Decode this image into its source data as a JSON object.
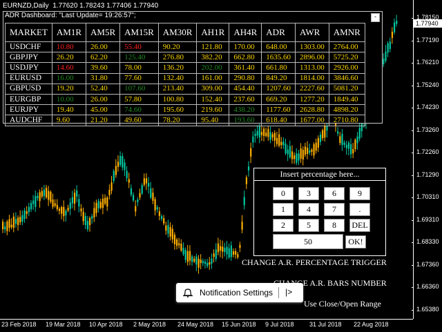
{
  "chart": {
    "title": "EURNZD,Daily  1.77620 1.78243 1.77406 1.77940",
    "current_price": "1.77940",
    "up_color": "#00c8a0",
    "down_color": "#ffb000",
    "price_labels": [
      "1.78150",
      "1.77190",
      "1.76210",
      "1.75240",
      "1.74230",
      "1.73260",
      "1.72260",
      "1.71290",
      "1.70310",
      "1.69310",
      "1.68330",
      "1.67360",
      "1.66360",
      "1.65380"
    ],
    "time_labels": [
      "23 Feb 2018",
      "19 Mar 2018",
      "10 Apr 2018",
      "2 May 2018",
      "24 May 2018",
      "15 Jun 2018",
      "9 Jul 2018",
      "31 Jul 2018",
      "22 Aug 2018"
    ]
  },
  "dashboard": {
    "title": "ADR Dashboard: \"Last Update= 19:26:57\";",
    "close_label": "-",
    "headers": [
      "MARKET",
      "AM1R",
      "AM5R",
      "AM15R",
      "AM30R",
      "AH1R",
      "AH4R",
      "ADR",
      "AWR",
      "AMNR"
    ],
    "rows": [
      {
        "symbol": "USDCHF",
        "cells": [
          {
            "v": "10.80",
            "c": "#ff2020"
          },
          {
            "v": "26.00",
            "c": "#ffd700"
          },
          {
            "v": "55.40",
            "c": "#ff2020"
          },
          {
            "v": "90.20",
            "c": "#ffd700"
          },
          {
            "v": "121.80",
            "c": "#ffd700"
          },
          {
            "v": "170.00",
            "c": "#ffd700"
          },
          {
            "v": "648.00",
            "c": "#ffd700"
          },
          {
            "v": "1303.00",
            "c": "#ffd700"
          },
          {
            "v": "2764.00",
            "c": "#ffd700"
          }
        ]
      },
      {
        "symbol": "GBPJPY",
        "cells": [
          {
            "v": "26.20",
            "c": "#ffd700"
          },
          {
            "v": "62.20",
            "c": "#ffd700"
          },
          {
            "v": "125.40",
            "c": "#228b22"
          },
          {
            "v": "276.80",
            "c": "#ffd700"
          },
          {
            "v": "382.20",
            "c": "#ffd700"
          },
          {
            "v": "662.80",
            "c": "#ffd700"
          },
          {
            "v": "1635.60",
            "c": "#ffd700"
          },
          {
            "v": "2896.00",
            "c": "#ffd700"
          },
          {
            "v": "5725.20",
            "c": "#ffd700"
          }
        ]
      },
      {
        "symbol": "USDJPY",
        "cells": [
          {
            "v": "14.60",
            "c": "#ff2020"
          },
          {
            "v": "39.60",
            "c": "#ffd700"
          },
          {
            "v": "78.00",
            "c": "#ffd700"
          },
          {
            "v": "136.20",
            "c": "#ffd700"
          },
          {
            "v": "202.00",
            "c": "#228b22"
          },
          {
            "v": "361.40",
            "c": "#ffd700"
          },
          {
            "v": "661.80",
            "c": "#ffd700"
          },
          {
            "v": "1313.00",
            "c": "#ffd700"
          },
          {
            "v": "2926.00",
            "c": "#ffd700"
          }
        ]
      },
      {
        "symbol": "EURUSD",
        "cells": [
          {
            "v": "16.00",
            "c": "#228b22"
          },
          {
            "v": "31.80",
            "c": "#ffd700"
          },
          {
            "v": "77.60",
            "c": "#ffd700"
          },
          {
            "v": "132.40",
            "c": "#ffd700"
          },
          {
            "v": "161.00",
            "c": "#ffd700"
          },
          {
            "v": "290.80",
            "c": "#ffd700"
          },
          {
            "v": "849.20",
            "c": "#ffd700"
          },
          {
            "v": "1814.00",
            "c": "#ffd700"
          },
          {
            "v": "3846.60",
            "c": "#ffd700"
          }
        ]
      },
      {
        "symbol": "GBPUSD",
        "cells": [
          {
            "v": "19.20",
            "c": "#ffd700"
          },
          {
            "v": "52.40",
            "c": "#ffd700"
          },
          {
            "v": "107.60",
            "c": "#228b22"
          },
          {
            "v": "213.40",
            "c": "#ffd700"
          },
          {
            "v": "309.00",
            "c": "#ffd700"
          },
          {
            "v": "454.40",
            "c": "#ffd700"
          },
          {
            "v": "1207.60",
            "c": "#ffd700"
          },
          {
            "v": "2227.60",
            "c": "#ffd700"
          },
          {
            "v": "5081.20",
            "c": "#ffd700"
          }
        ]
      },
      {
        "symbol": "EURGBP",
        "cells": [
          {
            "v": "10.00",
            "c": "#228b22"
          },
          {
            "v": "26.00",
            "c": "#ffd700"
          },
          {
            "v": "57.80",
            "c": "#ffd700"
          },
          {
            "v": "100.80",
            "c": "#ffd700"
          },
          {
            "v": "152.40",
            "c": "#ffd700"
          },
          {
            "v": "237.60",
            "c": "#ffd700"
          },
          {
            "v": "669.20",
            "c": "#ffd700"
          },
          {
            "v": "1277.20",
            "c": "#ffd700"
          },
          {
            "v": "1849.40",
            "c": "#ffd700"
          }
        ]
      },
      {
        "symbol": "EURJPY",
        "cells": [
          {
            "v": "19.40",
            "c": "#ffd700"
          },
          {
            "v": "45.00",
            "c": "#ffd700"
          },
          {
            "v": "74.60",
            "c": "#228b22"
          },
          {
            "v": "195.60",
            "c": "#ffd700"
          },
          {
            "v": "219.60",
            "c": "#ffd700"
          },
          {
            "v": "438.20",
            "c": "#228b22"
          },
          {
            "v": "1177.60",
            "c": "#ffd700"
          },
          {
            "v": "2628.80",
            "c": "#ffd700"
          },
          {
            "v": "4898.20",
            "c": "#ffd700"
          }
        ]
      },
      {
        "symbol": "AUDCHF",
        "cells": [
          {
            "v": "9.60",
            "c": "#ffd700"
          },
          {
            "v": "21.20",
            "c": "#ffd700"
          },
          {
            "v": "49.60",
            "c": "#ffd700"
          },
          {
            "v": "78.20",
            "c": "#ffd700"
          },
          {
            "v": "95.40",
            "c": "#ffd700"
          },
          {
            "v": "193.60",
            "c": "#228b22"
          },
          {
            "v": "618.40",
            "c": "#ffd700"
          },
          {
            "v": "1677.00",
            "c": "#ffd700"
          },
          {
            "v": "2710.80",
            "c": "#ffd700"
          }
        ]
      }
    ]
  },
  "input_panel": {
    "title": "Insert percentage here...",
    "keys": [
      "0",
      "3",
      "6",
      "9",
      "1",
      "4",
      "7",
      ".",
      "2",
      "5",
      "8",
      "DEL"
    ],
    "value": "50",
    "ok_label": "OK!"
  },
  "links": {
    "change_pct": "CHANGE A.R. PERCENTAGE TRIGGER",
    "change_bars": "CHANGE A.R. BARS NUMBER",
    "close_open": "Use Close/Open Range"
  },
  "notification": {
    "label": "Notification Settings",
    "arrow": "|>",
    "icon": "bell-icon"
  }
}
